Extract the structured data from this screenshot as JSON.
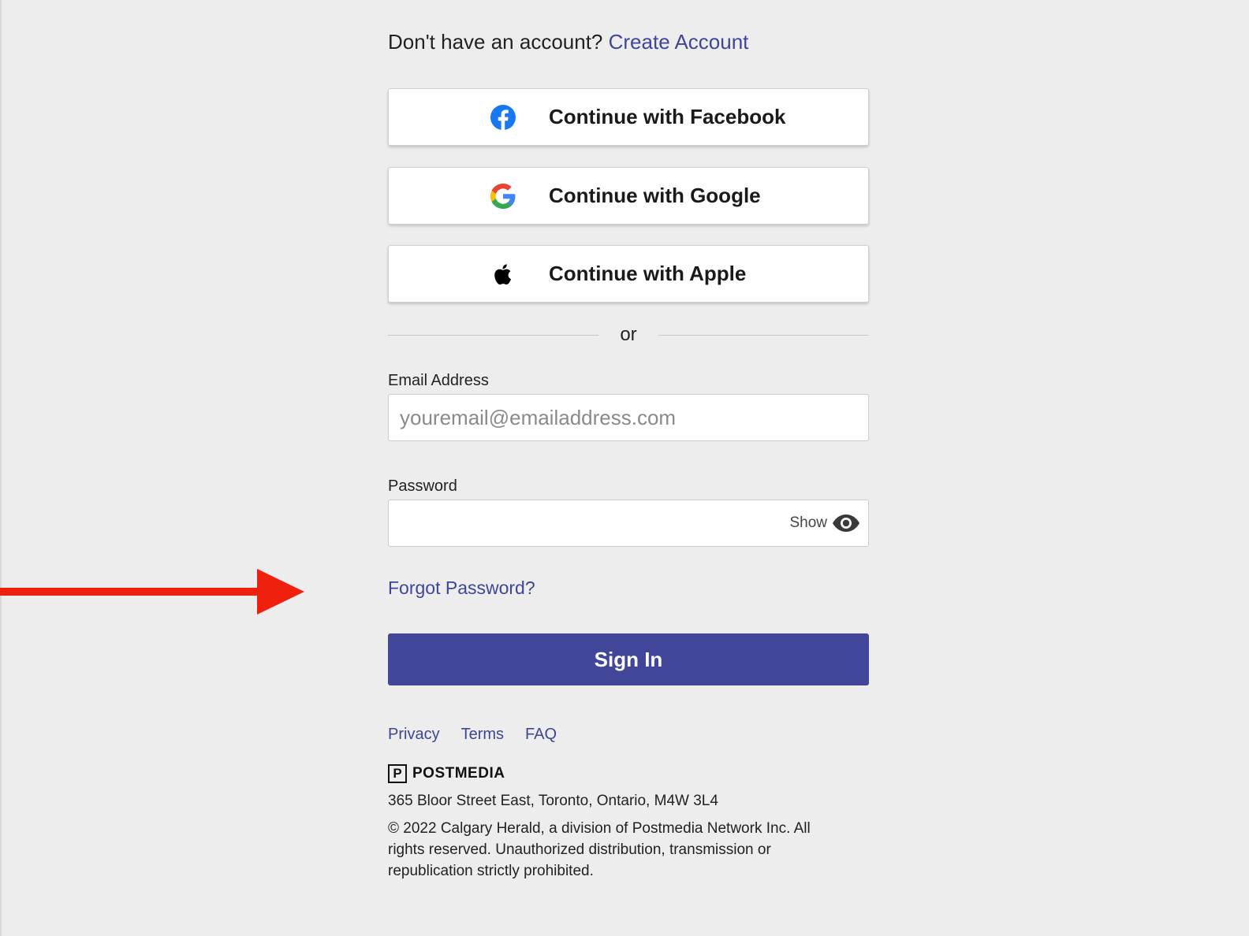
{
  "signup": {
    "prompt": "Don't have an account?",
    "link": "Create Account"
  },
  "social": {
    "facebook": {
      "label": "Continue with Facebook",
      "icon": "facebook-icon"
    },
    "google": {
      "label": "Continue with Google",
      "icon": "google-icon"
    },
    "apple": {
      "label": "Continue with Apple",
      "icon": "apple-icon"
    }
  },
  "divider": {
    "text": "or"
  },
  "email": {
    "label": "Email Address",
    "placeholder": "youremail@emailaddress.com",
    "value": ""
  },
  "password": {
    "label": "Password",
    "value": "",
    "show_label": "Show",
    "show_icon": "eye-icon"
  },
  "forgot_password": "Forgot Password?",
  "signin": {
    "label": "Sign In"
  },
  "footer": {
    "links": [
      "Privacy",
      "Terms",
      "FAQ"
    ],
    "logo_mark": "P",
    "logo_text": "POSTMEDIA",
    "address": "365 Bloor Street East, Toronto, Ontario, M4W 3L4",
    "copyright": "© 2022 Calgary Herald, a division of Postmedia Network Inc. All rights reserved. Unauthorized distribution, transmission or republication strictly prohibited."
  },
  "annotation": {
    "icon": "red-arrow-icon",
    "color": "#f0200e"
  },
  "colors": {
    "background": "#ededed",
    "link": "#3e4697",
    "primary_button": "#414698",
    "facebook_blue": "#1877f2"
  }
}
